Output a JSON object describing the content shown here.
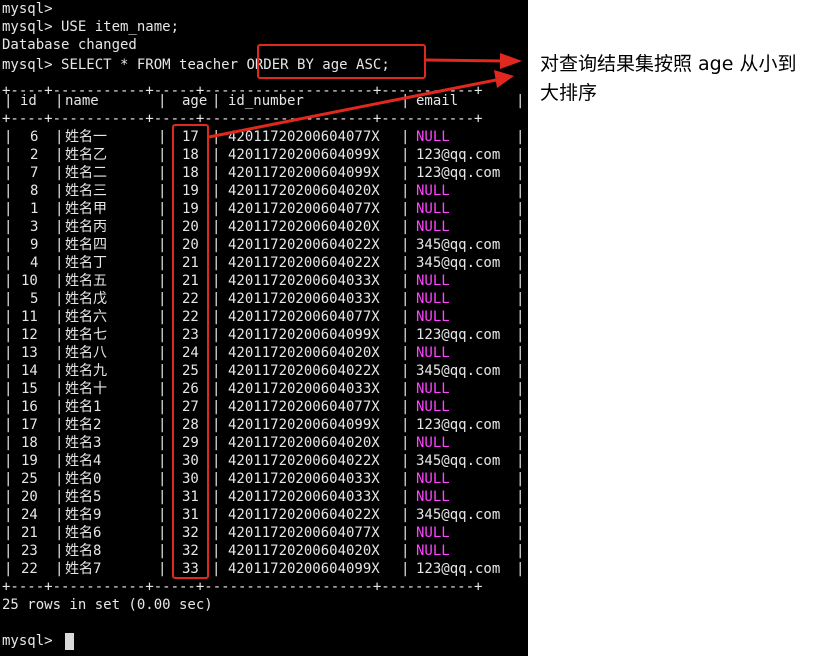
{
  "terminal": {
    "lines_before": [
      "mysql>",
      "mysql> USE item_name;",
      "Database changed"
    ],
    "query_prompt": "mysql> ",
    "query_pre": "SELECT * FROM teacher ",
    "query_hl": "ORDER BY age ASC;",
    "border": "+----+-----------+-----+--------------------+-----------+",
    "headers": [
      "id",
      "name",
      "age",
      "id_number",
      "email"
    ],
    "rows": [
      {
        "id": "6",
        "name": "姓名一",
        "age": "17",
        "id_number": "42011720200604077X",
        "email": "NULL"
      },
      {
        "id": "2",
        "name": "姓名乙",
        "age": "18",
        "id_number": "42011720200604099X",
        "email": "123@qq.com"
      },
      {
        "id": "7",
        "name": "姓名二",
        "age": "18",
        "id_number": "42011720200604099X",
        "email": "123@qq.com"
      },
      {
        "id": "8",
        "name": "姓名三",
        "age": "19",
        "id_number": "42011720200604020X",
        "email": "NULL"
      },
      {
        "id": "1",
        "name": "姓名甲",
        "age": "19",
        "id_number": "42011720200604077X",
        "email": "NULL"
      },
      {
        "id": "3",
        "name": "姓名丙",
        "age": "20",
        "id_number": "42011720200604020X",
        "email": "NULL"
      },
      {
        "id": "9",
        "name": "姓名四",
        "age": "20",
        "id_number": "42011720200604022X",
        "email": "345@qq.com"
      },
      {
        "id": "4",
        "name": "姓名丁",
        "age": "21",
        "id_number": "42011720200604022X",
        "email": "345@qq.com"
      },
      {
        "id": "10",
        "name": "姓名五",
        "age": "21",
        "id_number": "42011720200604033X",
        "email": "NULL"
      },
      {
        "id": "5",
        "name": "姓名戊",
        "age": "22",
        "id_number": "42011720200604033X",
        "email": "NULL"
      },
      {
        "id": "11",
        "name": "姓名六",
        "age": "22",
        "id_number": "42011720200604077X",
        "email": "NULL"
      },
      {
        "id": "12",
        "name": "姓名七",
        "age": "23",
        "id_number": "42011720200604099X",
        "email": "123@qq.com"
      },
      {
        "id": "13",
        "name": "姓名八",
        "age": "24",
        "id_number": "42011720200604020X",
        "email": "NULL"
      },
      {
        "id": "14",
        "name": "姓名九",
        "age": "25",
        "id_number": "42011720200604022X",
        "email": "345@qq.com"
      },
      {
        "id": "15",
        "name": "姓名十",
        "age": "26",
        "id_number": "42011720200604033X",
        "email": "NULL"
      },
      {
        "id": "16",
        "name": "姓名1",
        "age": "27",
        "id_number": "42011720200604077X",
        "email": "NULL"
      },
      {
        "id": "17",
        "name": "姓名2",
        "age": "28",
        "id_number": "42011720200604099X",
        "email": "123@qq.com"
      },
      {
        "id": "18",
        "name": "姓名3",
        "age": "29",
        "id_number": "42011720200604020X",
        "email": "NULL"
      },
      {
        "id": "19",
        "name": "姓名4",
        "age": "30",
        "id_number": "42011720200604022X",
        "email": "345@qq.com"
      },
      {
        "id": "25",
        "name": "姓名0",
        "age": "30",
        "id_number": "42011720200604033X",
        "email": "NULL"
      },
      {
        "id": "20",
        "name": "姓名5",
        "age": "31",
        "id_number": "42011720200604033X",
        "email": "NULL"
      },
      {
        "id": "24",
        "name": "姓名9",
        "age": "31",
        "id_number": "42011720200604022X",
        "email": "345@qq.com"
      },
      {
        "id": "21",
        "name": "姓名6",
        "age": "32",
        "id_number": "42011720200604077X",
        "email": "NULL"
      },
      {
        "id": "23",
        "name": "姓名8",
        "age": "32",
        "id_number": "42011720200604020X",
        "email": "NULL"
      },
      {
        "id": "22",
        "name": "姓名7",
        "age": "33",
        "id_number": "42011720200604099X",
        "email": "123@qq.com"
      }
    ],
    "summary": "25 rows in set (0.00 sec)",
    "final_prompt": "mysql> "
  },
  "annotation": {
    "text": "对查询结果集按照 age 从小到大排序"
  },
  "colors": {
    "background": "#000000",
    "text": "#e6e6e6",
    "null_value": "#ff44ff",
    "highlight": "#e0281e"
  }
}
